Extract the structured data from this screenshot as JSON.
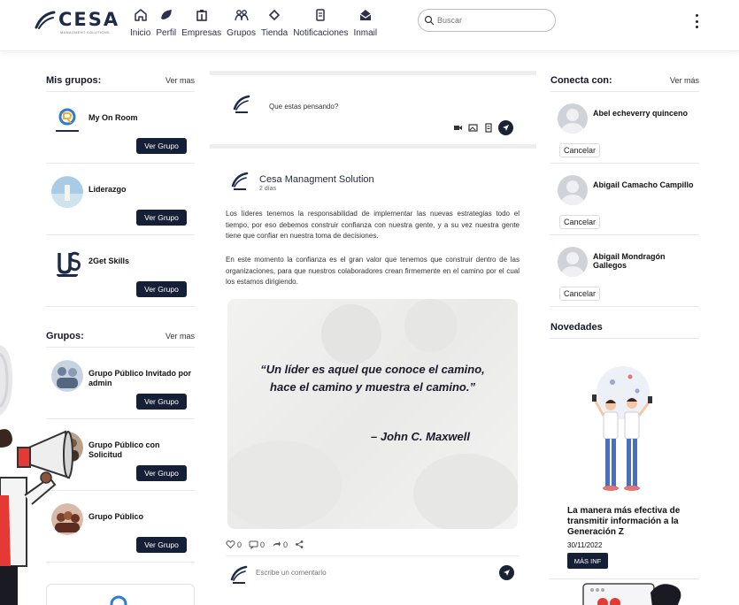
{
  "brand": {
    "name": "CESA",
    "tagline": "MANAGMENT SOLUTIONS"
  },
  "nav": [
    {
      "label": "Inicio",
      "icon": "home-icon"
    },
    {
      "label": "Perfil",
      "icon": "profile-icon"
    },
    {
      "label": "Empresas",
      "icon": "building-icon"
    },
    {
      "label": "Grupos",
      "icon": "groups-icon"
    },
    {
      "label": "Tienda",
      "icon": "tag-icon"
    },
    {
      "label": "Notificaciones",
      "icon": "notification-icon"
    },
    {
      "label": "Inmail",
      "icon": "mail-icon"
    }
  ],
  "search": {
    "placeholder": "Buscar"
  },
  "my_groups": {
    "title": "Mis grupos:",
    "more": "Ver mas",
    "items": [
      {
        "name": "My On Room",
        "button": "Ver Grupo"
      },
      {
        "name": "Liderazgo",
        "button": "Ver Grupo"
      },
      {
        "name": "2Get Skills",
        "button": "Ver Grupo"
      }
    ]
  },
  "groups": {
    "title": "Grupos:",
    "more": "Ver mas",
    "items": [
      {
        "name": "Grupo Público Invitado por admin",
        "button": "Ver Grupo"
      },
      {
        "name": "Grupo Público con Solicitud",
        "button": "Ver Grupo"
      },
      {
        "name": "Grupo Público",
        "button": "Ver Grupo"
      }
    ]
  },
  "composer": {
    "placeholder": "Que estas pensando?"
  },
  "post": {
    "author": "Cesa Managment Solution",
    "time": "2 días",
    "paragraph1": "Los líderes tenemos la responsabilidad de implementar las nuevas estrategias todo el tiempo, por eso debemos construir confianza con nuestra gente, y a su vez nuestra gente tiene que confiar en nuestra toma de decisiones.",
    "paragraph2": "En este momento la confianza es el gran valor que tenemos que construir dentro de las organizaciones, para que nuestros colaboradores crean firmemente en el camino por el cual los estamos dirigiendo.",
    "quote": "“Un líder es aquel que conoce el camino, hace el camino y muestra el camino.”",
    "quote_author": "– John C. Maxwell",
    "likes": "0",
    "comments": "0",
    "shares": "0",
    "comment_placeholder": "Escribe un comentario"
  },
  "connect": {
    "title": "Conecta con:",
    "more": "Ver más",
    "items": [
      {
        "name": "Abel echeverry quinceno",
        "button": "Cancelar"
      },
      {
        "name": "Abigail Camacho Campillo",
        "button": "Cancelar"
      },
      {
        "name": "Abigail Mondragón Gallegos",
        "button": "Cancelar"
      }
    ]
  },
  "news": {
    "title": "Novedades",
    "headline": "La manera más efectiva de transmitir información a la Generación Z",
    "date": "30/11/2022",
    "button": "MÁS INF"
  },
  "colors": {
    "primary": "#152036",
    "accent_red": "#e53935",
    "text": "#1c2233"
  }
}
